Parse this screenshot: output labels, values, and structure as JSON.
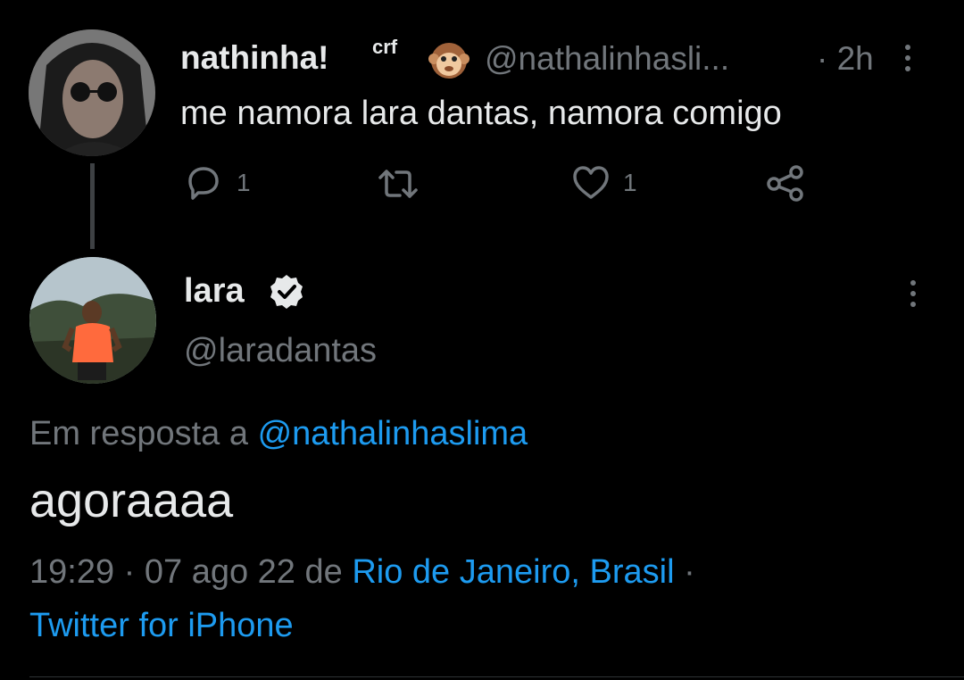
{
  "tweet1": {
    "display_name": "nathinha!",
    "superscript": "crf",
    "emoji": "🐵",
    "handle": "@nathalinhasli...",
    "time": "· 2h",
    "text": "me namora lara dantas, namora comigo",
    "reply_count": "1",
    "like_count": "1",
    "icons": [
      "reply-icon",
      "retweet-icon",
      "like-icon",
      "share-icon",
      "more-icon"
    ]
  },
  "tweet2": {
    "display_name": "lara",
    "handle": "@laradantas",
    "reply_prefix": "Em resposta a",
    "reply_handle": "@nathalinhaslima",
    "text": "agoraaaa",
    "time": "19:29",
    "sep1": "·",
    "date": "07 ago 22",
    "from": "de",
    "location": "Rio de Janeiro, Brasil",
    "sep2": "·",
    "client": "Twitter for iPhone",
    "icons": [
      "verified-icon",
      "more-icon"
    ]
  },
  "colors": {
    "background": "#000000",
    "text": "#e7e9ea",
    "muted": "#71767b",
    "link": "#1d9bf0"
  }
}
